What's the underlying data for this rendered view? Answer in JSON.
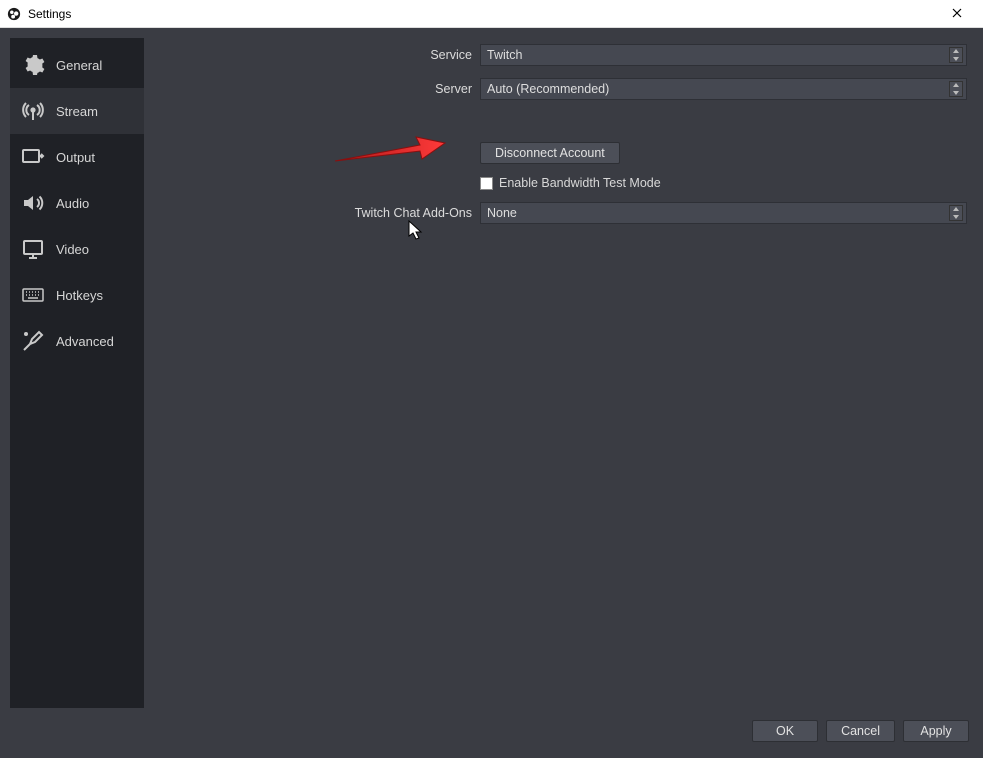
{
  "window": {
    "title": "Settings"
  },
  "sidebar": {
    "items": [
      {
        "label": "General"
      },
      {
        "label": "Stream"
      },
      {
        "label": "Output"
      },
      {
        "label": "Audio"
      },
      {
        "label": "Video"
      },
      {
        "label": "Hotkeys"
      },
      {
        "label": "Advanced"
      }
    ],
    "selected_index": 1
  },
  "stream_settings": {
    "service_label": "Service",
    "service_value": "Twitch",
    "server_label": "Server",
    "server_value": "Auto (Recommended)",
    "disconnect_button": "Disconnect Account",
    "bandwidth_test_label": "Enable Bandwidth Test Mode",
    "bandwidth_test_checked": false,
    "chat_addons_label": "Twitch Chat Add-Ons",
    "chat_addons_value": "None"
  },
  "footer": {
    "ok": "OK",
    "cancel": "Cancel",
    "apply": "Apply"
  }
}
